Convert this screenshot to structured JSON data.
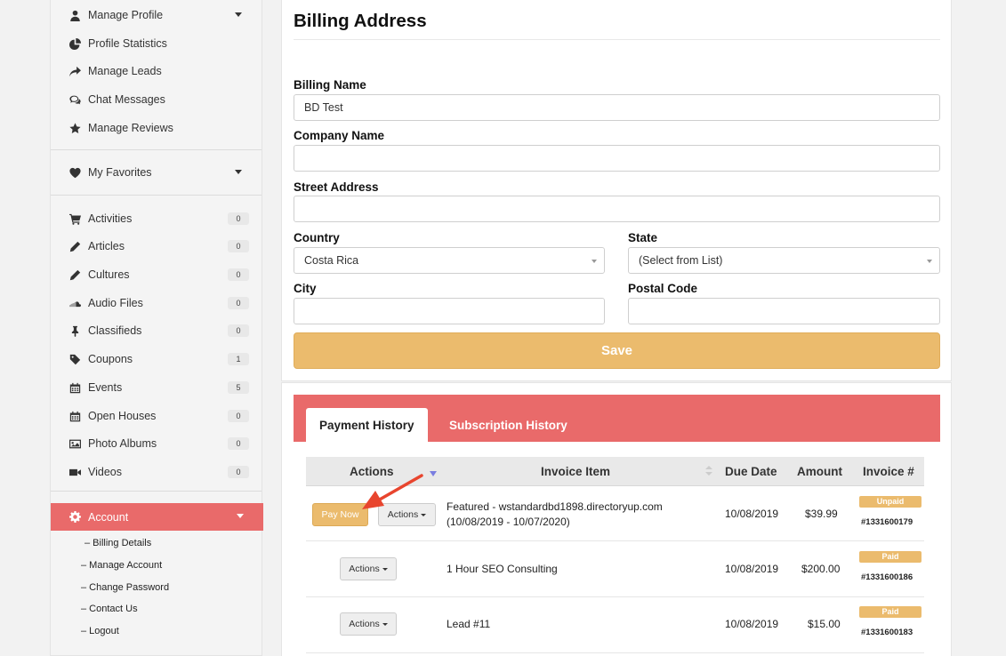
{
  "sidebar": {
    "top_items": [
      {
        "label": "Manage Profile",
        "icon": "user-icon",
        "caret": true
      },
      {
        "label": "Profile Statistics",
        "icon": "pie-chart-icon"
      },
      {
        "label": "Manage Leads",
        "icon": "share-arrow-icon"
      },
      {
        "label": "Chat Messages",
        "icon": "chat-bubbles-icon"
      },
      {
        "label": "Manage Reviews",
        "icon": "star-icon"
      }
    ],
    "favorites": {
      "label": "My Favorites",
      "icon": "heart-icon"
    },
    "content_items": [
      {
        "label": "Activities",
        "icon": "cart-icon",
        "count": "0"
      },
      {
        "label": "Articles",
        "icon": "pencil-icon",
        "count": "0"
      },
      {
        "label": "Cultures",
        "icon": "pencil-icon",
        "count": "0"
      },
      {
        "label": "Audio Files",
        "icon": "soundcloud-icon",
        "count": "0"
      },
      {
        "label": "Classifieds",
        "icon": "pushpin-icon",
        "count": "0"
      },
      {
        "label": "Coupons",
        "icon": "tag-icon",
        "count": "1"
      },
      {
        "label": "Events",
        "icon": "calendar-icon",
        "count": "5"
      },
      {
        "label": "Open Houses",
        "icon": "calendar-icon",
        "count": "0"
      },
      {
        "label": "Photo Albums",
        "icon": "image-icon",
        "count": "0"
      },
      {
        "label": "Videos",
        "icon": "video-camera-icon",
        "count": "0"
      }
    ],
    "account": {
      "label": "Account",
      "icon": "gear-icon"
    },
    "account_sub": [
      "– Billing Details",
      "– Manage Account",
      "– Change Password",
      "– Contact Us",
      "– Logout"
    ]
  },
  "billing": {
    "title": "Billing Address",
    "billing_name_label": "Billing Name",
    "billing_name_value": "BD Test",
    "company_label": "Company Name",
    "company_value": "",
    "street_label": "Street Address",
    "street_value": "",
    "country_label": "Country",
    "country_value": "Costa Rica",
    "state_label": "State",
    "state_value": "(Select from List)",
    "city_label": "City",
    "city_value": "",
    "postal_label": "Postal Code",
    "postal_value": "",
    "save_label": "Save"
  },
  "history": {
    "tabs": [
      "Payment History",
      "Subscription History"
    ],
    "columns": [
      "Actions",
      "Invoice Item",
      "Due Date",
      "Amount",
      "Invoice #"
    ],
    "rows": [
      {
        "pay_label": "Pay Now",
        "actions_label": "Actions",
        "item_line1": "Featured - wstandardbd1898.directoryup.com",
        "item_line2": "(10/08/2019 - 10/07/2020)",
        "due": "10/08/2019",
        "amount": "$39.99",
        "status": "Unpaid",
        "invoice": "#1331600179"
      },
      {
        "actions_label": "Actions",
        "item_line1": "1 Hour SEO Consulting",
        "due": "10/08/2019",
        "amount": "$200.00",
        "status": "Paid",
        "invoice": "#1331600186"
      },
      {
        "actions_label": "Actions",
        "item_line1": "Lead #11",
        "due": "10/08/2019",
        "amount": "$15.00",
        "status": "Paid",
        "invoice": "#1331600183"
      }
    ]
  },
  "colors": {
    "accent_red": "#e96a6a",
    "accent_gold": "#ebbb6d",
    "arrow_red": "#e8452e"
  }
}
